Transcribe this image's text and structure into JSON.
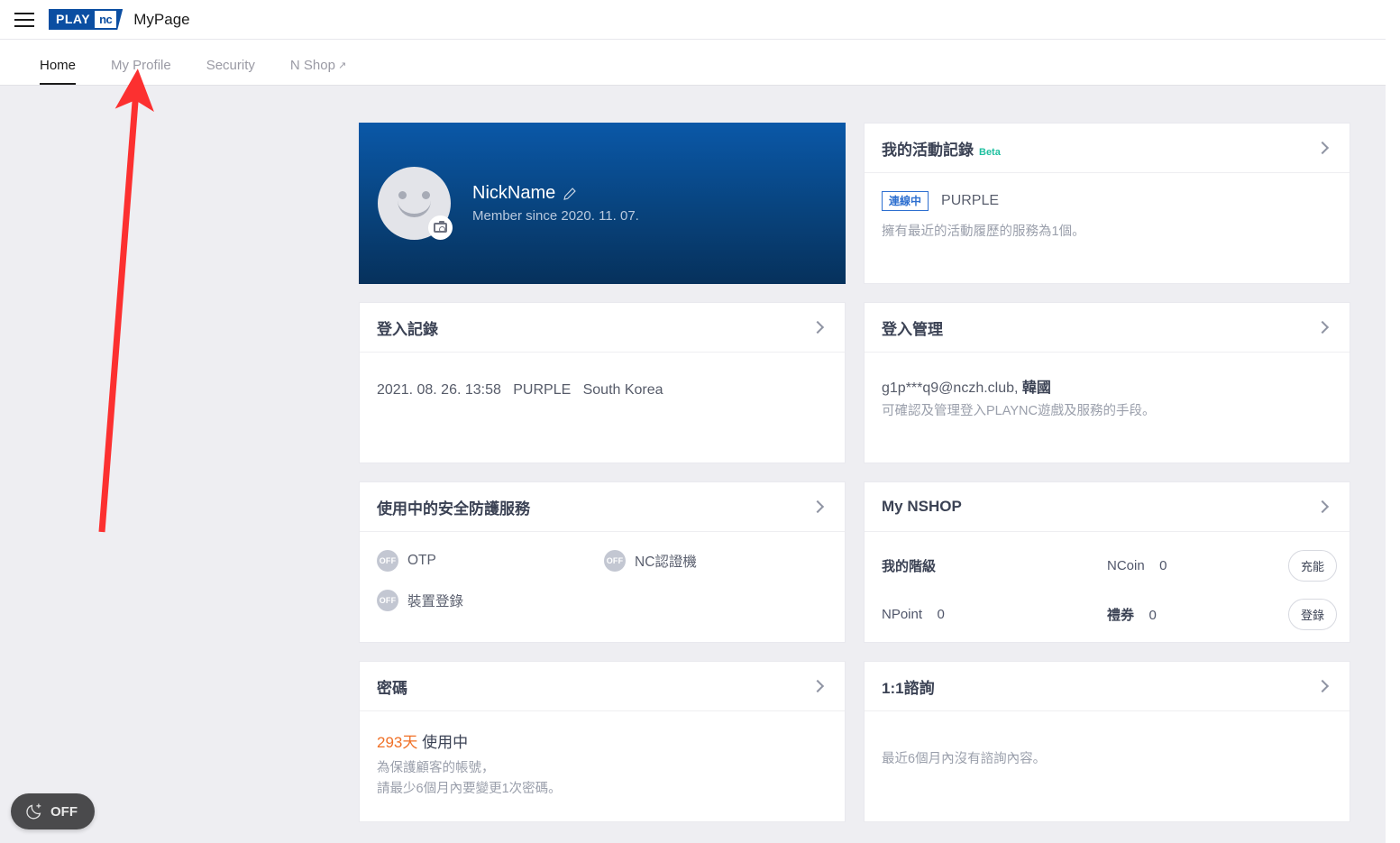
{
  "header": {
    "menu_icon": "hamburger-icon",
    "logo_play": "PLAY",
    "logo_nc": "nc",
    "title": "MyPage"
  },
  "nav": {
    "tabs": [
      {
        "label": "Home",
        "active": true,
        "external": false
      },
      {
        "label": "My Profile",
        "active": false,
        "external": false
      },
      {
        "label": "Security",
        "active": false,
        "external": false
      },
      {
        "label": "N Shop",
        "active": false,
        "external": true
      }
    ],
    "external_marker": "↗"
  },
  "profile": {
    "nickname": "NickName",
    "member_since": "Member since 2020. 11. 07.",
    "edit_icon": "pencil-icon",
    "camera_icon": "camera-icon",
    "avatar_icon": "smiley-avatar-icon"
  },
  "activity": {
    "title": "我的活動記錄",
    "beta": "Beta",
    "status_badge": "連線中",
    "service": "PURPLE",
    "description": "擁有最近的活動履歷的服務為1個。"
  },
  "login_record": {
    "title": "登入記錄",
    "entry": "2021. 08. 26. 13:58   PURPLE   South Korea"
  },
  "login_manage": {
    "title": "登入管理",
    "account": "g1p***q9@nczh.club,",
    "country": "韓國",
    "description": "可確認及管理登入PLAYNC遊戲及服務的手段。"
  },
  "security": {
    "title": "使用中的安全防護服務",
    "items": [
      {
        "state": "OFF",
        "label": "OTP"
      },
      {
        "state": "OFF",
        "label": "NC認證機"
      },
      {
        "state": "OFF",
        "label": "裝置登錄"
      }
    ]
  },
  "nshop": {
    "title": "My NSHOP",
    "rows": [
      {
        "k1": "我的階級",
        "v1": "",
        "k2": "NCoin",
        "v2": "0",
        "action": "充能"
      },
      {
        "k1": "NPoint",
        "v1": "0",
        "k2": "禮券",
        "v2": "0",
        "action": "登錄"
      }
    ]
  },
  "password": {
    "title": "密碼",
    "days": "293天",
    "state": "使用中",
    "line1": "為保護顧客的帳號，",
    "line2": "請最少6個月內要變更1次密碼。"
  },
  "consult": {
    "title": "1:1諮詢",
    "empty": "最近6個月內沒有諮詢內容。"
  },
  "dark_mode": {
    "icon": "moon-plus-icon",
    "label": "OFF"
  },
  "annotation": {
    "arrow_color": "#fc3030",
    "points_to": "My Profile"
  },
  "colors": {
    "accent_blue": "#0b4ea2",
    "beta_green": "#1fc0a0",
    "badge_blue": "#2d6fd0",
    "warn_orange": "#f07026",
    "page_bg": "#eeeef2"
  }
}
